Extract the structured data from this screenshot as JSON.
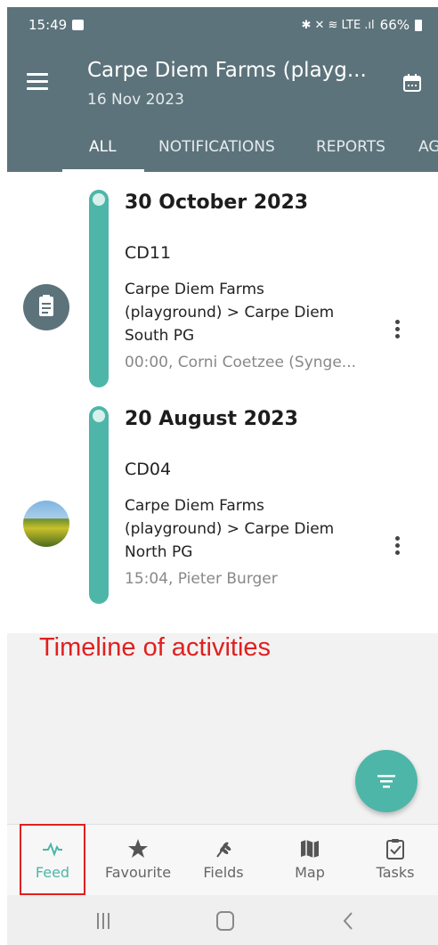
{
  "status_bar": {
    "time": "15:49",
    "icons_text": "✱ ✕ ≋ LTE .ıl",
    "battery": "66%"
  },
  "app_bar": {
    "title": "Carpe Diem Farms (playg...",
    "date": "16 Nov 2023",
    "menu_icon": "hamburger-icon",
    "calendar_icon": "calendar-icon"
  },
  "tabs": [
    {
      "label": "ALL",
      "active": true
    },
    {
      "label": "NOTIFICATIONS",
      "active": false
    },
    {
      "label": "REPORTS",
      "active": false
    },
    {
      "label": "AG",
      "active": false
    }
  ],
  "feed": {
    "entries": [
      {
        "date": "30 October 2023",
        "code": "CD11",
        "location_line1": "Carpe Diem Farms",
        "location_line2": "(playground) > Carpe Diem",
        "location_line3": "South PG",
        "meta": "00:00, Corni Coetzee (Synge...",
        "avatar": "clipboard-icon"
      },
      {
        "date": "20 August 2023",
        "code": "CD04",
        "location_line1": "Carpe Diem Farms",
        "location_line2": "(playground) > Carpe Diem",
        "location_line3": "North PG",
        "meta": "15:04, Pieter Burger",
        "avatar": "field-photo"
      }
    ]
  },
  "annotation": "Timeline of activities",
  "bottom_nav": [
    {
      "label": "Feed",
      "icon": "pulse-icon",
      "active": true
    },
    {
      "label": "Favourite",
      "icon": "star-icon",
      "active": false
    },
    {
      "label": "Fields",
      "icon": "wheat-icon",
      "active": false
    },
    {
      "label": "Map",
      "icon": "map-icon",
      "active": false
    },
    {
      "label": "Tasks",
      "icon": "task-check-icon",
      "active": false
    }
  ],
  "colors": {
    "app_bar": "#5c737b",
    "accent": "#4db6a8",
    "annotation": "#e0201f"
  }
}
